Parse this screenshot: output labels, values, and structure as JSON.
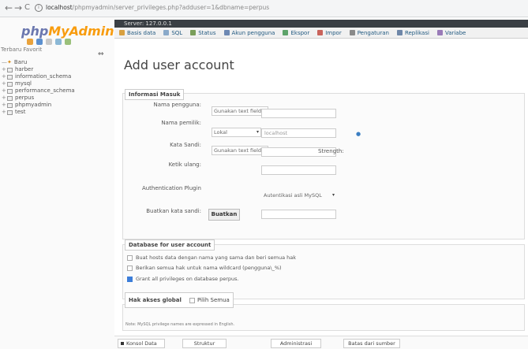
{
  "browser": {
    "back": "←",
    "forward": "→",
    "reload": "C",
    "url_host": "localhost",
    "url_path": "/phpmyadmin/server_privileges.php?adduser=1&dbname=perpus"
  },
  "sidebar": {
    "logo_a": "php",
    "logo_b": "MyAdmin",
    "tabs": "Terbaru  Favorit",
    "collapse": "⇔",
    "tree": [
      {
        "label": "Baru",
        "new": true
      },
      {
        "label": "harber"
      },
      {
        "label": "information_schema"
      },
      {
        "label": "mysql"
      },
      {
        "label": "performance_schema"
      },
      {
        "label": "perpus"
      },
      {
        "label": "phpmyadmin"
      },
      {
        "label": "test"
      }
    ]
  },
  "server_bar": "Server: 127.0.0.1",
  "tabs": [
    {
      "label": "Basis data",
      "color": "#d8a040"
    },
    {
      "label": "SQL",
      "color": "#8aa9c9"
    },
    {
      "label": "Status",
      "color": "#7a9e5a"
    },
    {
      "label": "Akun pengguna",
      "color": "#6d88b3"
    },
    {
      "label": "Ekspor",
      "color": "#5ea36a"
    },
    {
      "label": "Impor",
      "color": "#c9635b"
    },
    {
      "label": "Pengaturan",
      "color": "#8a8a8a"
    },
    {
      "label": "Replikasi",
      "color": "#6f87a8"
    },
    {
      "label": "Variabe",
      "color": "#9a7bb8"
    }
  ],
  "page_title": "Add user account",
  "login_info": {
    "legend": "Informasi Masuk",
    "username_label": "Nama pengguna:",
    "username_mode": "Gunakan text field",
    "hostname_label": "Nama pemilik:",
    "hostname_mode": "Lokal",
    "hostname_value": "localhost",
    "password_label": "Kata Sandi:",
    "password_mode": "Gunakan text field",
    "strength_label": "Strength:",
    "retype_label": "Ketik ulang:",
    "auth_label": "Authentication Plugin",
    "auth_value": "Autentikasi asli MySQL",
    "generate_label": "Buatkan kata sandi:",
    "generate_button": "Buatkan"
  },
  "database_section": {
    "legend": "Database for user account",
    "options": [
      {
        "label": "Buat hosts data dengan nama yang sama dan beri semua hak",
        "checked": false
      },
      {
        "label": "Berikan semua hak untuk nama wildcard (pengguna\\_%)",
        "checked": false
      },
      {
        "label": "Grant all privileges on database perpus.",
        "checked": true
      }
    ]
  },
  "global_privs": {
    "legend": "Hak akses global",
    "check_all": "Pilih Semua",
    "note": "Note: MySQL privilege names are expressed in English."
  },
  "bottom_tabs": [
    "Konsol Data",
    "Struktur",
    "Administrasi",
    "Batas dari sumber"
  ]
}
